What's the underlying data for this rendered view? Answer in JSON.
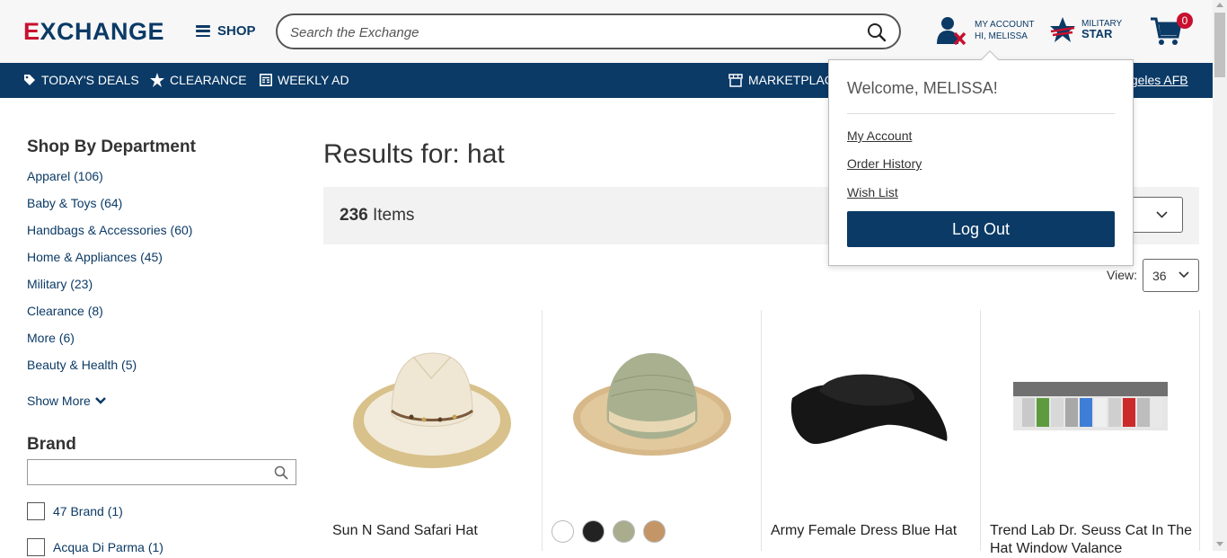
{
  "header": {
    "logo": {
      "accent": "E",
      "rest": "XCHANGE"
    },
    "shop_label": "SHOP",
    "search_placeholder": "Search the Exchange",
    "account_line1": "MY ACCOUNT",
    "account_line2": "HI, MELISSA",
    "mstar_line1": "MILITARY",
    "mstar_line2": "STAR",
    "cart_count": "0"
  },
  "nav": {
    "deals": "TODAY'S DEALS",
    "clearance": "CLEARANCE",
    "weekly_ad": "WEEKLY AD",
    "marketplace": "MARKETPLACE",
    "location": "Los Angeles AFB"
  },
  "sidebar": {
    "dept_title": "Shop By Department",
    "departments": [
      "Apparel (106)",
      "Baby & Toys (64)",
      "Handbags & Accessories (60)",
      "Home & Appliances (45)",
      "Military (23)",
      "Clearance (8)",
      "More (6)",
      "Beauty & Health (5)"
    ],
    "show_more": "Show More",
    "brand_title": "Brand",
    "brands": [
      "47 Brand (1)",
      "Acqua Di Parma (1)"
    ]
  },
  "main": {
    "results_title": "Results for: hat",
    "count_number": "236",
    "count_label": " Items",
    "view_label": "View:",
    "view_value": "36",
    "products": [
      {
        "name": "Sun N Sand Safari Hat"
      },
      {
        "name": ""
      },
      {
        "name": "Army Female Dress Blue Hat"
      },
      {
        "name": "Trend Lab Dr. Seuss Cat In The Hat Window Valance"
      }
    ],
    "swatch_colors": [
      "#ffffff",
      "#222222",
      "#a9ad8e",
      "#c49566"
    ]
  },
  "dropdown": {
    "welcome": "Welcome, MELISSA!",
    "my_account": "My Account",
    "order_history": "Order History",
    "wish_list": "Wish List",
    "logout": "Log Out"
  },
  "colors": {
    "brand_navy": "#0b3a66",
    "brand_red": "#c8102e"
  }
}
